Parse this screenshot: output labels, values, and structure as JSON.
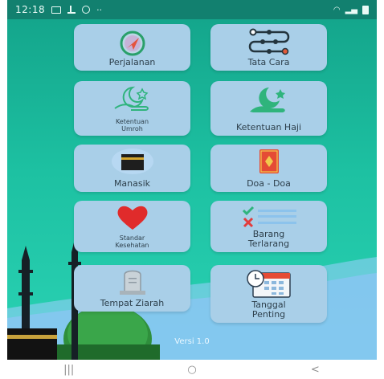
{
  "status_bar": {
    "time": "12:18",
    "left_icons": [
      "image-icon",
      "upload-icon",
      "at-icon",
      "more-dots-icon"
    ],
    "right_icons": [
      "wifi-icon",
      "signal-icon",
      "battery-icon"
    ]
  },
  "menu": {
    "perjalanan": "Perjalanan",
    "tata_cara": "Tata Cara",
    "ketentuan_umroh_1": "Ketentuan",
    "ketentuan_umroh_2": "Umroh",
    "ketentuan_haji": "Ketentuan Haji",
    "manasik": "Manasik",
    "doa_doa": "Doa - Doa",
    "standar_kesehatan_1": "Standar",
    "standar_kesehatan_2": "Kesehatan",
    "barang_terlarang_1": "Barang",
    "barang_terlarang_2": "Terlarang",
    "tempat_ziarah": "Tempat Ziarah",
    "tanggal_penting_1": "Tanggal",
    "tanggal_penting_2": "Penting"
  },
  "version_text": "Versi 1.0",
  "colors": {
    "status_bar": "#12806f",
    "background_top": "#14a68c",
    "tile": "#a9cfe8",
    "wave": "#9fd0ff"
  },
  "nav_bar": {
    "recent": "|||",
    "home": "○",
    "back": "<"
  }
}
